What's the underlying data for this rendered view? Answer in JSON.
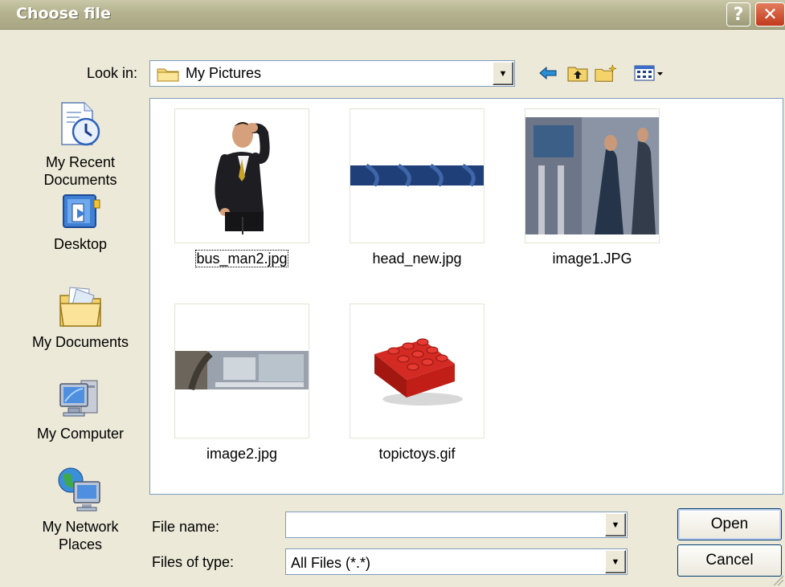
{
  "window": {
    "title": "Choose file",
    "help_glyph": "?",
    "close_glyph": "✕"
  },
  "toolbar": {
    "look_in_label": "Look in:",
    "look_in_value": "My Pictures",
    "icons": [
      "back-arrow-icon",
      "up-folder-icon",
      "new-folder-icon",
      "view-menu-icon"
    ]
  },
  "places": [
    {
      "label_line1": "My Recent",
      "label_line2": "Documents",
      "icon": "recent-documents-icon"
    },
    {
      "label_line1": "Desktop",
      "label_line2": "",
      "icon": "desktop-icon"
    },
    {
      "label_line1": "My Documents",
      "label_line2": "",
      "icon": "my-documents-icon"
    },
    {
      "label_line1": "My Computer",
      "label_line2": "",
      "icon": "my-computer-icon"
    },
    {
      "label_line1": "My Network",
      "label_line2": "Places",
      "icon": "network-places-icon"
    }
  ],
  "files": [
    {
      "name": "bus_man2.jpg",
      "selected": true
    },
    {
      "name": "head_new.jpg",
      "selected": false
    },
    {
      "name": "image1.JPG",
      "selected": false
    },
    {
      "name": "image2.jpg",
      "selected": false
    },
    {
      "name": "topictoys.gif",
      "selected": false
    }
  ],
  "form": {
    "file_name_label": "File name:",
    "file_name_value": "",
    "file_type_label": "Files of type:",
    "file_type_value": "All Files (*.*)"
  },
  "buttons": {
    "open": "Open",
    "cancel": "Cancel"
  },
  "colors": {
    "title_bar": "#b4b28e",
    "dialog_bg": "#ECE9D8",
    "close_button": "#c2391c",
    "border_blue": "#7f9db9"
  }
}
